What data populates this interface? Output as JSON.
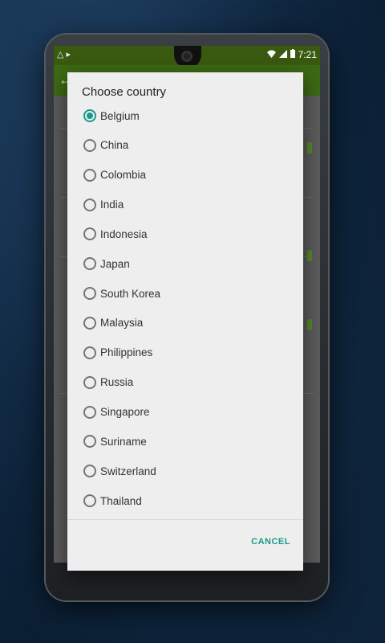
{
  "statusbar": {
    "time": "7:21",
    "battery_icon": "battery-icon",
    "signal_icon": "signal-icon",
    "wifi_icon": "wifi-icon"
  },
  "dialog": {
    "title": "Choose country",
    "selected": "Belgium",
    "options": [
      {
        "label": "Belgium",
        "checked": true
      },
      {
        "label": "China",
        "checked": false
      },
      {
        "label": "Colombia",
        "checked": false
      },
      {
        "label": "India",
        "checked": false
      },
      {
        "label": "Indonesia",
        "checked": false
      },
      {
        "label": "Japan",
        "checked": false
      },
      {
        "label": "South Korea",
        "checked": false
      },
      {
        "label": "Malaysia",
        "checked": false
      },
      {
        "label": "Philippines",
        "checked": false
      },
      {
        "label": "Russia",
        "checked": false
      },
      {
        "label": "Singapore",
        "checked": false
      },
      {
        "label": "Suriname",
        "checked": false
      },
      {
        "label": "Switzerland",
        "checked": false
      },
      {
        "label": "Thailand",
        "checked": false
      }
    ],
    "cancel_label": "CANCEL"
  },
  "colors": {
    "accent": "#1a9a8a",
    "appbar": "#3d6a14"
  }
}
